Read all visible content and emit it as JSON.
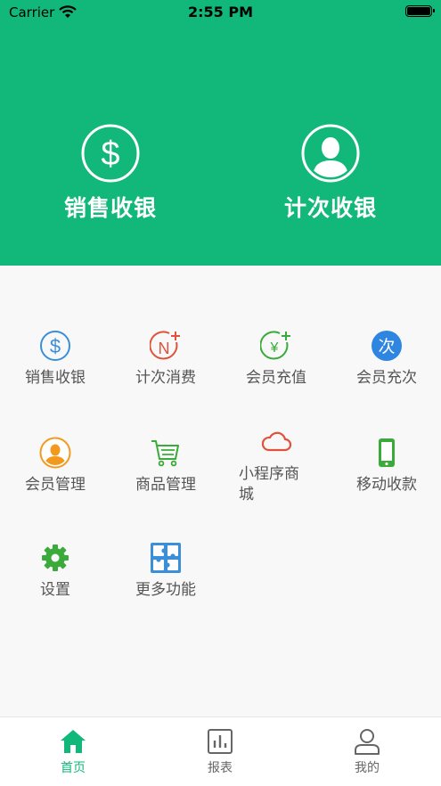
{
  "status_bar": {
    "carrier": "Carrier",
    "time": "2:55 PM"
  },
  "hero": {
    "items": [
      {
        "label": "销售收银",
        "icon": "dollar-circle-icon"
      },
      {
        "label": "计次收银",
        "icon": "user-circle-icon"
      }
    ]
  },
  "menu": {
    "items": [
      {
        "label": "销售收银",
        "icon": "dollar-icon",
        "color": "#3b8fd9"
      },
      {
        "label": "计次消费",
        "icon": "n-plus-icon",
        "color": "#e0533a"
      },
      {
        "label": "会员充值",
        "icon": "yen-plus-icon",
        "color": "#3aaa3a"
      },
      {
        "label": "会员充次",
        "icon": "ci-badge-icon",
        "color": "#2e86e0",
        "badge_text": "次"
      },
      {
        "label": "会员管理",
        "icon": "member-icon",
        "color": "#f39a1e"
      },
      {
        "label": "商品管理",
        "icon": "cart-icon",
        "color": "#3aaa3a"
      },
      {
        "label": "小程序商城",
        "icon": "cloud-icon",
        "color": "#e0533a"
      },
      {
        "label": "移动收款",
        "icon": "phone-icon",
        "color": "#3aaa3a"
      },
      {
        "label": "设置",
        "icon": "gear-icon",
        "color": "#3aaa3a"
      },
      {
        "label": "更多功能",
        "icon": "puzzle-icon",
        "color": "#3b8fd9"
      }
    ]
  },
  "tabbar": {
    "items": [
      {
        "label": "首页",
        "icon": "home-icon",
        "active": true
      },
      {
        "label": "报表",
        "icon": "chart-icon",
        "active": false
      },
      {
        "label": "我的",
        "icon": "profile-icon",
        "active": false
      }
    ]
  },
  "colors": {
    "brand": "#12b87a",
    "background": "#f8f8f8",
    "text_muted": "#555555"
  }
}
